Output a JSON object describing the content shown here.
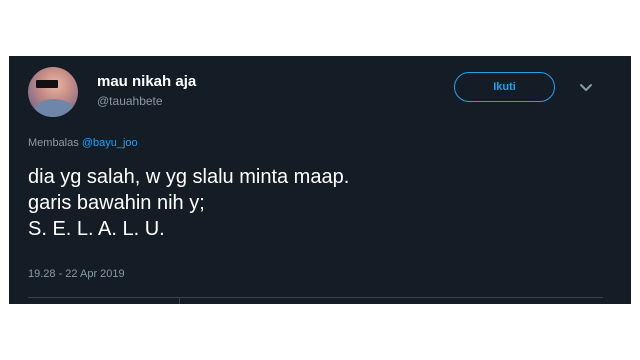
{
  "tweet": {
    "display_name": "mau nikah aja",
    "username": "@tauahbete",
    "follow_label": "Ikuti",
    "reply_prefix": "Membalas",
    "reply_to": "@bayu_joo",
    "text_lines": [
      "dia yg salah, w yg slalu minta maap.",
      "garis bawahin nih y;",
      "S. E. L. A. L. U."
    ],
    "timestamp": "19.28 - 22 Apr 2019"
  },
  "icons": {
    "menu": "chevron-down-icon",
    "avatar": "profile-photo"
  },
  "colors": {
    "background": "#141d26",
    "accent": "#1da1f2",
    "secondary_text": "#8899a6",
    "primary_text": "#ffffff"
  }
}
